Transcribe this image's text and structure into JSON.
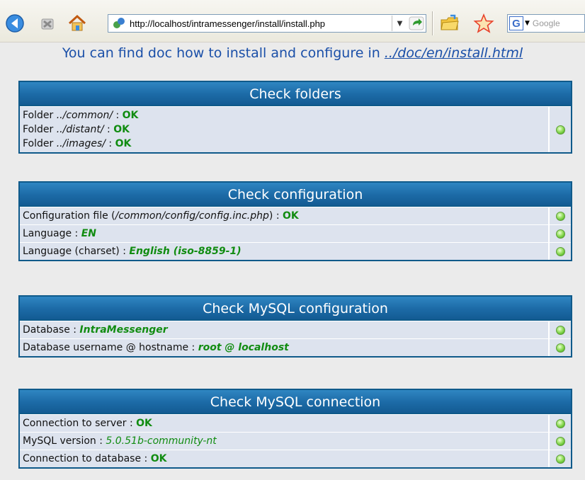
{
  "browser": {
    "url": "http://localhost/intramessenger/install/install.php",
    "search_placeholder": "Google",
    "search_engine_letter": "G"
  },
  "intro": {
    "text": "You can find doc how to install and configure in ",
    "link": "../doc/en/install.html"
  },
  "folders": {
    "title": "Check folders",
    "rows": [
      {
        "label": "Folder ",
        "path": "../common/",
        "sep": " : ",
        "status": "OK"
      },
      {
        "label": "Folder ",
        "path": "../distant/",
        "sep": " : ",
        "status": "OK"
      },
      {
        "label": "Folder ",
        "path": "../images/",
        "sep": " : ",
        "status": "OK"
      }
    ]
  },
  "configuration": {
    "title": "Check configuration",
    "config_file": {
      "label": "Configuration file (",
      "path": "/common/config/config.inc.php",
      "after": ") : ",
      "status": "OK"
    },
    "language": {
      "label": "Language : ",
      "value": "EN"
    },
    "charset": {
      "label": "Language (charset) : ",
      "value": "English (iso-8859-1)"
    }
  },
  "mysql_config": {
    "title": "Check MySQL configuration",
    "database": {
      "label": "Database : ",
      "value": "IntraMessenger"
    },
    "user_host": {
      "label": "Database username @ hostname : ",
      "value": "root @ localhost"
    }
  },
  "mysql_conn": {
    "title": "Check MySQL connection",
    "server": {
      "label": "Connection to server : ",
      "status": "OK"
    },
    "version": {
      "label": "MySQL version : ",
      "value": "5.0.51b-community-nt"
    },
    "database": {
      "label": "Connection to database : ",
      "status": "OK"
    }
  }
}
